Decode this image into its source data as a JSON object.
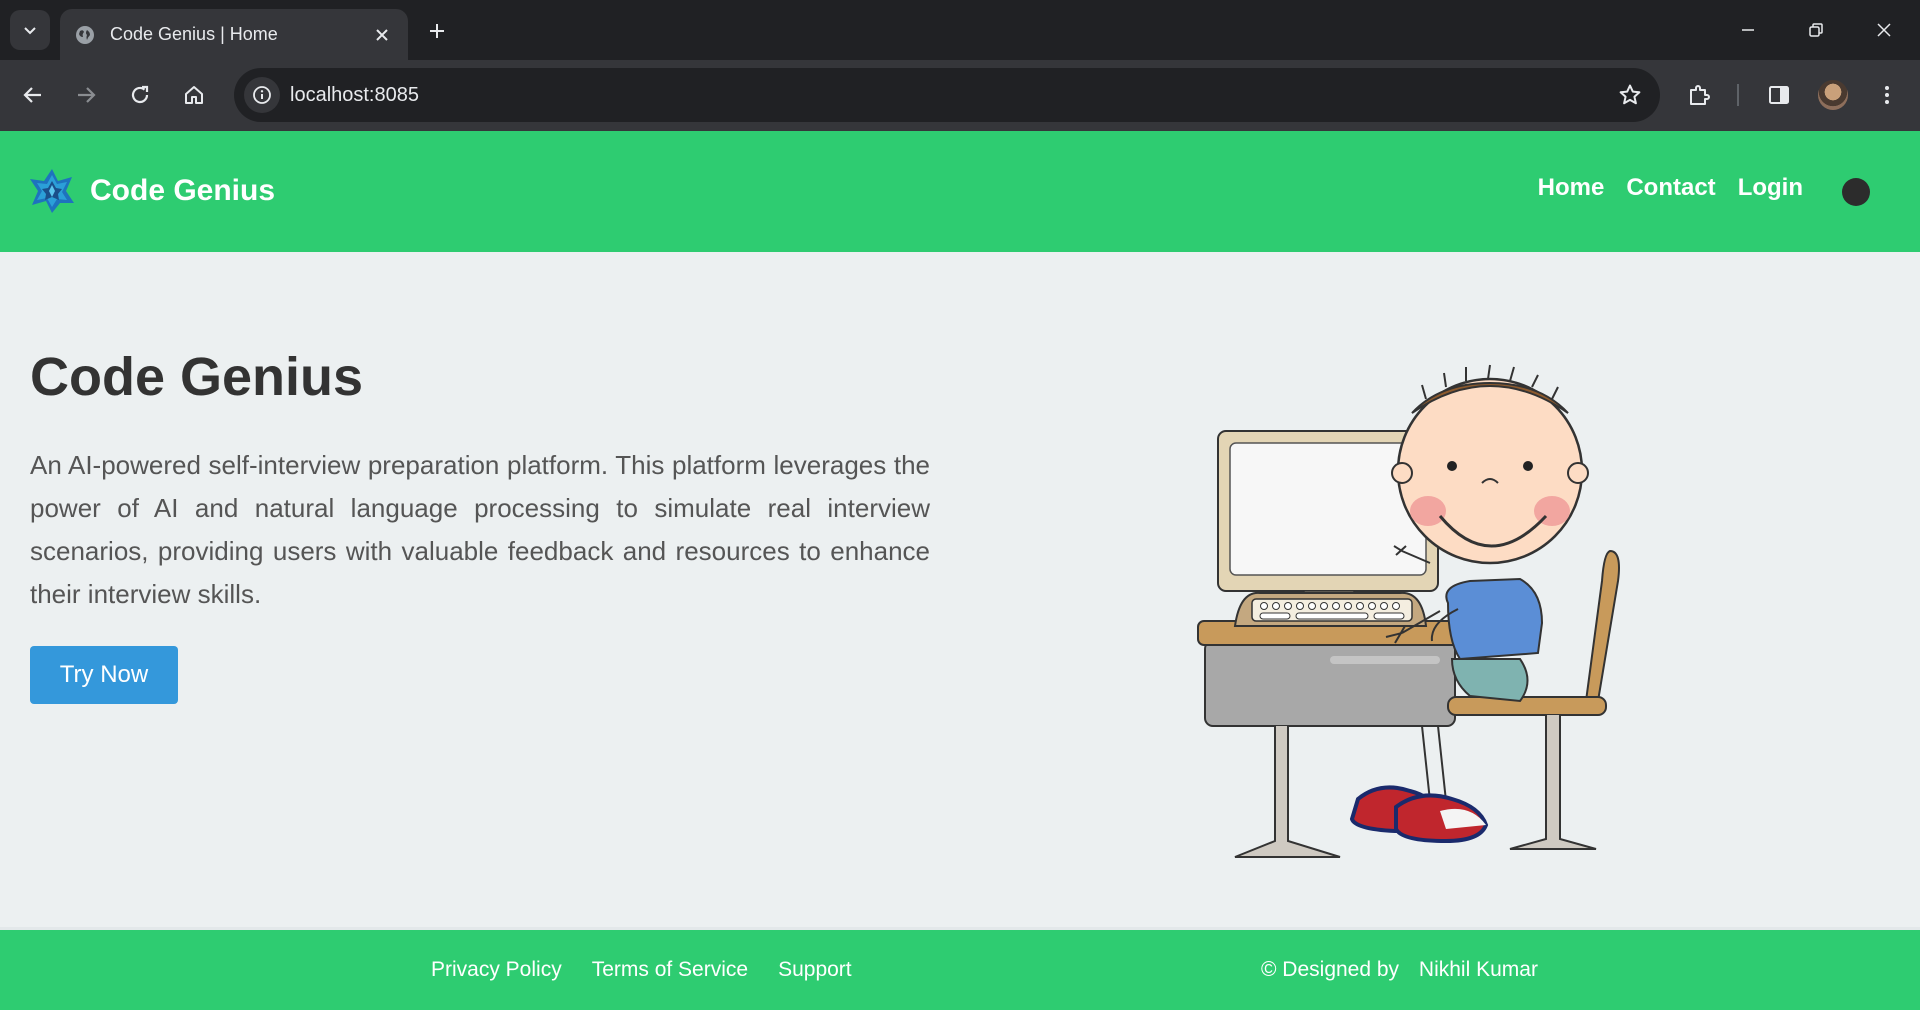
{
  "browser": {
    "tab_title": "Code Genius | Home",
    "url": "localhost:8085"
  },
  "navbar": {
    "brand": "Code Genius",
    "links": [
      "Home",
      "Contact",
      "Login"
    ]
  },
  "hero": {
    "title": "Code Genius",
    "description": "An AI-powered self-interview preparation platform. This platform leverages the power of AI and natural language processing to simulate real interview scenarios, providing users with valuable feedback and resources to enhance their interview skills.",
    "cta": "Try Now"
  },
  "footer": {
    "links": [
      "Privacy Policy",
      "Terms of Service",
      "Support"
    ],
    "credit_prefix": "© Designed by",
    "credit_name": "Nikhil Kumar"
  },
  "colors": {
    "primary_green": "#2ecc71",
    "button_blue": "#3498db",
    "page_bg": "#ecf0f1"
  }
}
